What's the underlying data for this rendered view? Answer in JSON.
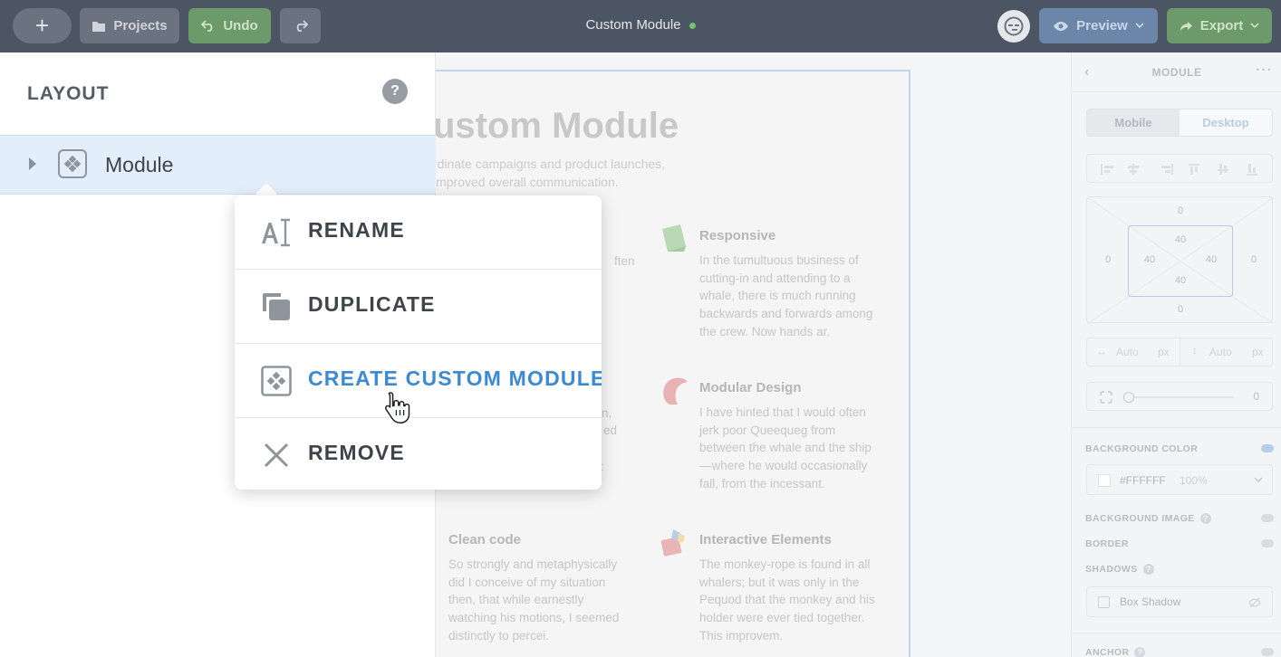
{
  "topbar": {
    "add_label": "+",
    "projects_label": "Projects",
    "undo_label": "Undo",
    "title": "Custom Module",
    "status_color": "#72c46a",
    "preview_label": "Preview",
    "export_label": "Export"
  },
  "left_panel": {
    "title": "LAYOUT",
    "help_label": "?",
    "tree": [
      {
        "label": "Module",
        "icon": "module-icon",
        "expanded": false,
        "selected": true
      }
    ]
  },
  "context_menu": {
    "items": [
      {
        "label": "RENAME",
        "icon": "rename-icon"
      },
      {
        "label": "DUPLICATE",
        "icon": "duplicate-icon"
      },
      {
        "label": "CREATE CUSTOM MODULE",
        "icon": "module-icon",
        "hovered": true
      },
      {
        "label": "REMOVE",
        "icon": "close-icon"
      }
    ],
    "accent_color": "#3c8ad4"
  },
  "canvas": {
    "heading": "ustom Module",
    "subtitle": "rdinate campaigns and product launches, improved overall communication.",
    "fragments": [
      "ften",
      "n,",
      "ed",
      ":"
    ],
    "features": [
      {
        "title": "Responsive",
        "body": "In the tumultuous business of cutting-in and attending to a whale, there is much running backwards and forwards among the crew. Now hands ar."
      },
      {
        "title": "Modular Design",
        "body": "I have hinted that I would often jerk poor Queequeg from between the whale and the ship—where he would occasionally fall, from the incessant."
      },
      {
        "title": "Clean code",
        "body": "So strongly and metaphysically did I conceive of my situation then, that while earnestly watching his motions, I seemed distinctly to percei."
      },
      {
        "title": "Interactive Elements",
        "body": "The monkey-rope is found in all whalers; but it was only in the Pequod that the monkey and his holder were ever tied together. This improvem."
      }
    ]
  },
  "right_panel": {
    "title": "MODULE",
    "more_label": "···",
    "tabs": [
      "Mobile",
      "Desktop"
    ],
    "active_tab": "Desktop",
    "spacing": {
      "margin_top": "0",
      "margin_right": "0",
      "margin_bottom": "0",
      "margin_left": "0",
      "padding_top": "40",
      "padding_right": "40",
      "padding_bottom": "40",
      "padding_left": "40"
    },
    "width_value": "Auto",
    "width_unit": "px",
    "height_value": "Auto",
    "height_unit": "px",
    "radius_value": "0",
    "background_color_label": "BACKGROUND COLOR",
    "background_color": "#FFFFFF",
    "background_opacity": "100%",
    "background_image_label": "BACKGROUND IMAGE",
    "border_label": "BORDER",
    "shadows_label": "SHADOWS",
    "box_shadow_label": "Box Shadow",
    "anchor_label": "ANCHOR",
    "help_label": "?"
  }
}
